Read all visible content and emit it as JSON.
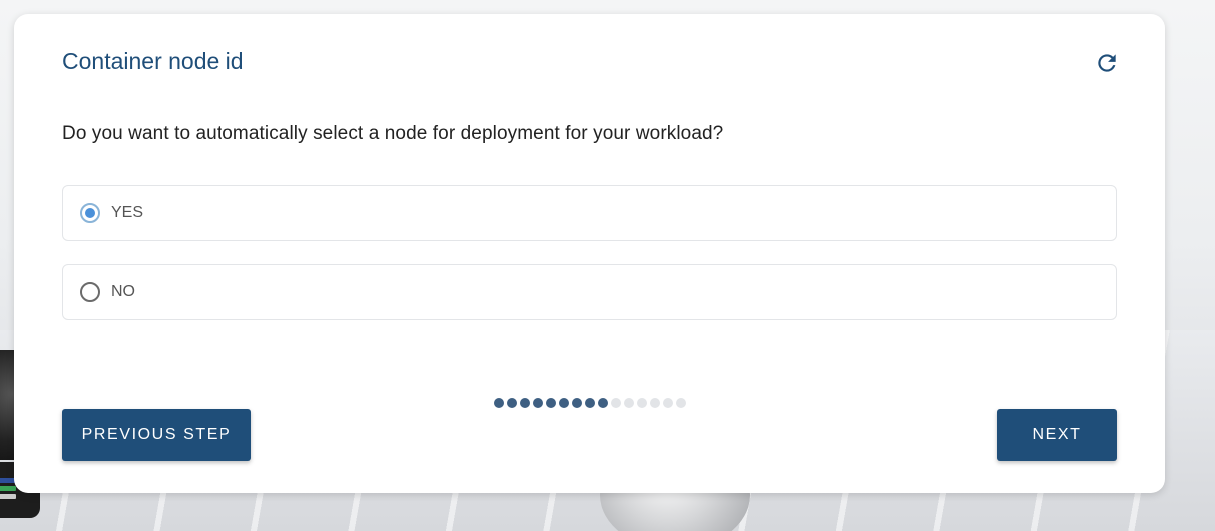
{
  "card": {
    "title": "Container node id",
    "question": "Do you want to automatically select a node for deployment for your workload?"
  },
  "options": [
    {
      "label": "YES",
      "selected": true
    },
    {
      "label": "NO",
      "selected": false
    }
  ],
  "progress": {
    "completed_steps": 9,
    "total_steps": 15
  },
  "buttons": {
    "previous_label": "PREVIOUS STEP",
    "next_label": "NEXT"
  },
  "icons": {
    "refresh": "refresh-icon"
  },
  "colors": {
    "primary": "#1f4e79",
    "radio_selected": "#4a90d9",
    "dot_active": "#3e5f82",
    "dot_inactive": "#e2e4e7"
  }
}
